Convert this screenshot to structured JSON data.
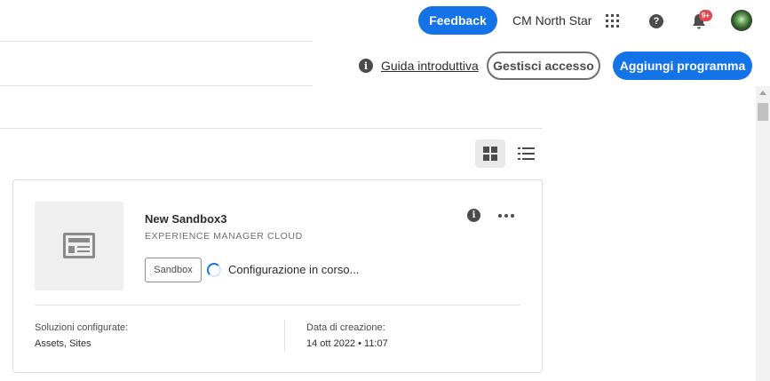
{
  "header": {
    "feedback_label": "Feedback",
    "org_name": "CM North Star",
    "notification_badge": "9+",
    "icons": [
      "apps-icon",
      "help-icon",
      "bell-icon",
      "avatar"
    ]
  },
  "subheader": {
    "guide_link": "Guida introduttiva",
    "manage_access_label": "Gestisci accesso",
    "add_program_label": "Aggiungi programma"
  },
  "program_card": {
    "name": "New Sandbox3",
    "subtitle": "EXPERIENCE MANAGER CLOUD",
    "tag": "Sandbox",
    "status": "Configurazione in corso...",
    "solutions_label": "Soluzioni configurate:",
    "solutions_value": "Assets, Sites",
    "created_label": "Data di creazione:",
    "created_value": "14 ott 2022 • 11:07"
  },
  "colors": {
    "accent": "#1473e6",
    "badge": "#e34850",
    "text": "#2c2c2c",
    "muted": "#6e6e6e"
  }
}
